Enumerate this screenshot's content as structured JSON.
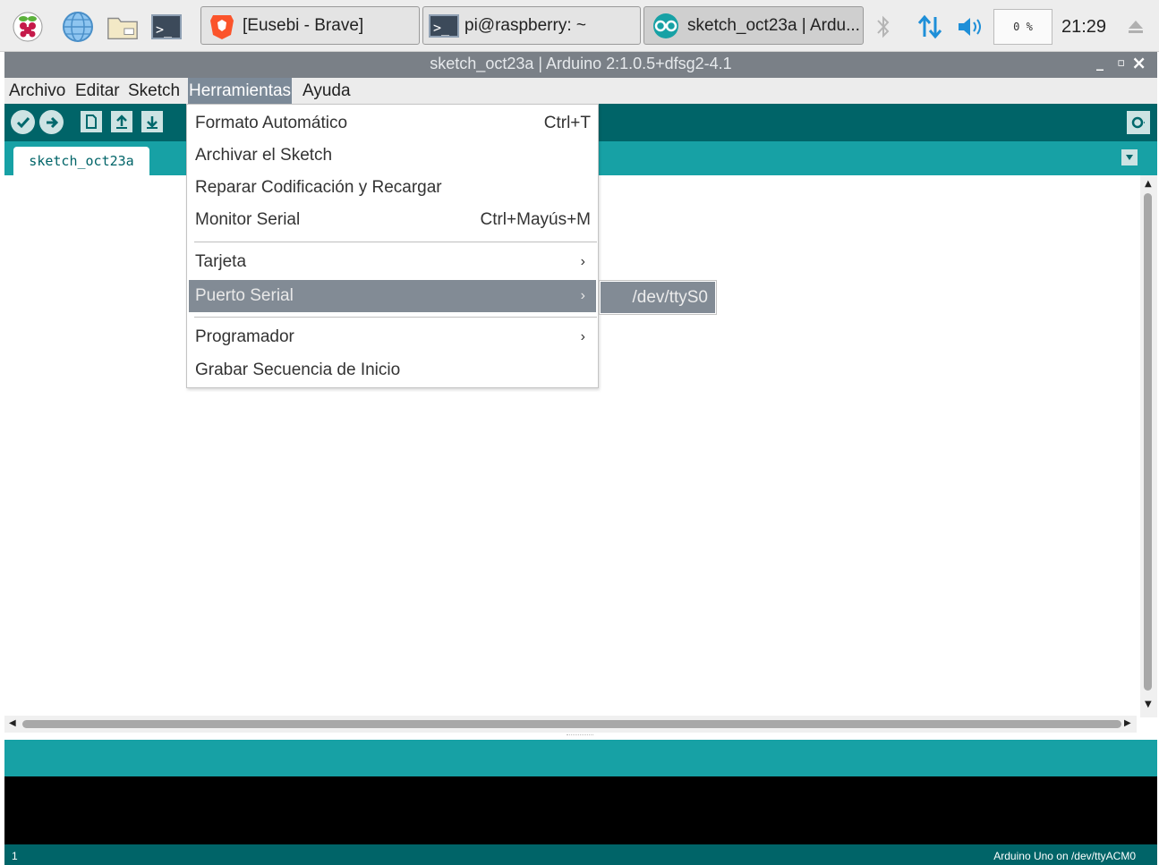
{
  "taskbar": {
    "launchers": [
      "raspberry-menu",
      "web-browser",
      "file-manager",
      "terminal"
    ],
    "tasks": [
      {
        "label": "[Eusebi - Brave]",
        "icon": "brave-icon"
      },
      {
        "label": "pi@raspberry: ~",
        "icon": "terminal-icon"
      },
      {
        "label": "sketch_oct23a | Ardu...",
        "icon": "arduino-icon"
      }
    ],
    "cpu_label": "0 %",
    "clock": "21:29"
  },
  "window": {
    "title": "sketch_oct23a | Arduino 2:1.0.5+dfsg2-4.1",
    "controls": {
      "minimize": "_",
      "maximize": "▫",
      "close": "×"
    }
  },
  "menubar": {
    "items": [
      "Archivo",
      "Editar",
      "Sketch",
      "Herramientas",
      "Ayuda"
    ],
    "open": "Herramientas"
  },
  "tools_menu": {
    "items": [
      {
        "label": "Formato Automático",
        "shortcut": "Ctrl+T"
      },
      {
        "label": "Archivar el Sketch",
        "shortcut": ""
      },
      {
        "label": "Reparar Codificación y Recargar",
        "shortcut": ""
      },
      {
        "label": "Monitor Serial",
        "shortcut": "Ctrl+Mayús+M"
      },
      {
        "label": "Tarjeta",
        "submenu": true
      },
      {
        "label": "Puerto Serial",
        "submenu": true,
        "highlighted": true
      },
      {
        "label": "Programador",
        "submenu": true
      },
      {
        "label": "Grabar Secuencia de Inicio",
        "shortcut": ""
      }
    ]
  },
  "serial_submenu": {
    "items": [
      "/dev/ttyS0"
    ]
  },
  "editor": {
    "tab_label": "sketch_oct23a",
    "content": ""
  },
  "status": {
    "line_number": "1",
    "board_port": "Arduino Uno on /dev/ttyACM0"
  },
  "colors": {
    "teal_dark": "#006468",
    "teal": "#17a1a5",
    "menu_highlight": "#828b95",
    "titlebar": "#7a8087"
  }
}
